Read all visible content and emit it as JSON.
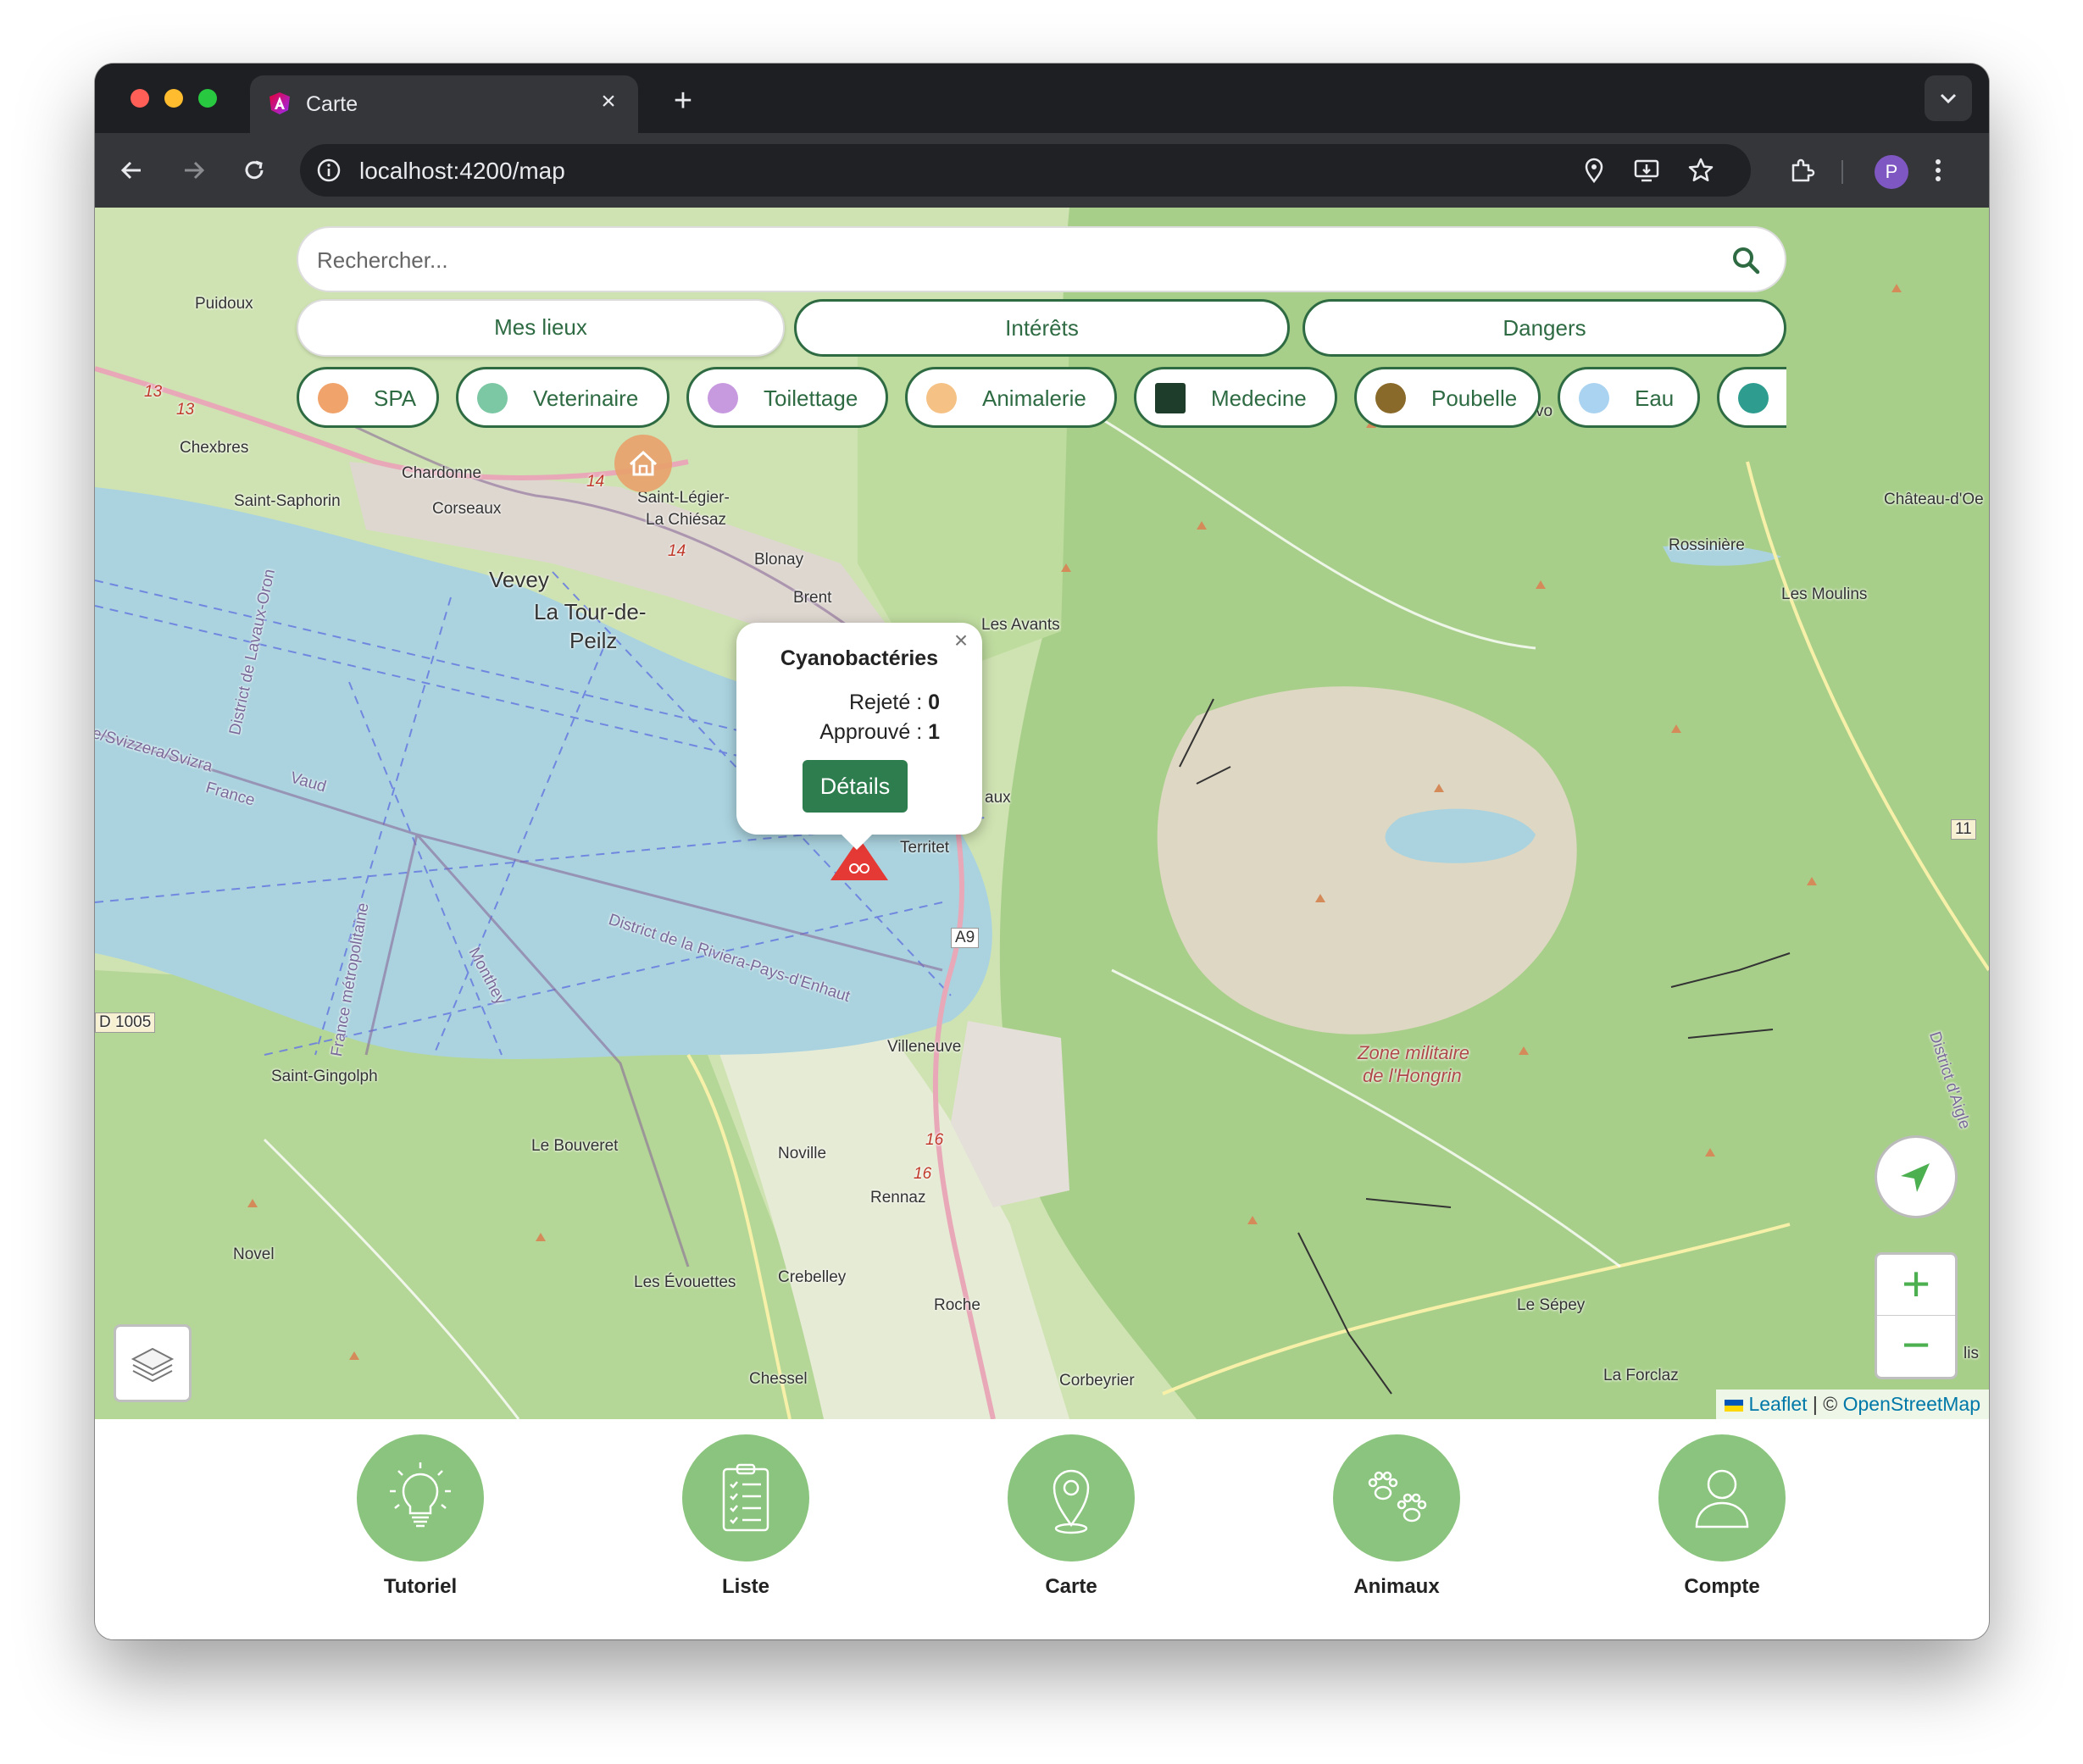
{
  "browser": {
    "tab_title": "Carte",
    "url": "localhost:4200/map",
    "profile_initial": "P"
  },
  "search": {
    "placeholder": "Rechercher..."
  },
  "categories": [
    {
      "label": "Mes lieux",
      "active": true
    },
    {
      "label": "Intérêts",
      "active": false
    },
    {
      "label": "Dangers",
      "active": false
    }
  ],
  "chips": [
    {
      "label": "SPA",
      "icon": "spa-icon",
      "color": "#f0a36b"
    },
    {
      "label": "Veterinaire",
      "icon": "veterinaire-icon",
      "color": "#7cc7a4"
    },
    {
      "label": "Toilettage",
      "icon": "toilettage-icon",
      "color": "#c79ae0"
    },
    {
      "label": "Animalerie",
      "icon": "animalerie-icon",
      "color": "#f5c185"
    },
    {
      "label": "Medecine",
      "icon": "medecine-icon",
      "color": "#1f3d2b"
    },
    {
      "label": "Poubelle",
      "icon": "poubelle-icon",
      "color": "#8a6a2a"
    },
    {
      "label": "Eau",
      "icon": "eau-icon",
      "color": "#a9d3f0"
    },
    {
      "label": "",
      "icon": "other-icon",
      "color": "#2e9c8f"
    }
  ],
  "map": {
    "labels": {
      "puidoux": "Puidoux",
      "chexbres": "Chexbres",
      "chardonne": "Chardonne",
      "saint_saphorin": "Saint-Saphorin",
      "corseaux": "Corseaux",
      "saint_legier": "Saint-Légier-",
      "la_chiesaz": "La Chiésaz",
      "blonay": "Blonay",
      "vevey": "Vevey",
      "la_tour_de": "La Tour-de-",
      "peilz": "Peilz",
      "brent": "Brent",
      "les_avants": "Les Avants",
      "territet": "Territet",
      "aux": "aux",
      "a9": "A9",
      "villeneuve": "Villeneuve",
      "saint_gingolph": "Saint-Gingolph",
      "d1005": "D 1005",
      "le_bouveret": "Le Bouveret",
      "noville": "Noville",
      "rennaz": "Rennaz",
      "novel": "Novel",
      "les_evouettes": "Les Évouettes",
      "crebelley": "Crebelley",
      "roche": "Roche",
      "chessel": "Chessel",
      "corbeyrier": "Corbeyrier",
      "le_sepey": "Le Sépey",
      "la_forclaz": "La Forclaz",
      "rossiniere": "Rossinière",
      "les_moulins": "Les Moulins",
      "chateau_doex": "Château-d'Oe",
      "zone_militaire_1": "Zone militaire",
      "zone_militaire_2": "de l'Hongrin",
      "svizzera": "e/Svizzera/Svizra",
      "france": "France",
      "vaud": "Vaud",
      "district_lavaux": "District de Lavaux-Oron",
      "district_riviera": "District de la Riviera-Pays-d'Enhaut",
      "monthey": "Monthey",
      "france_metro": "France métropolitaine",
      "district_aigle": "District d'Aigle",
      "route_13a": "13",
      "route_13b": "13",
      "route_14a": "14",
      "route_14b": "14",
      "route_16a": "16",
      "route_16b": "16",
      "route_11": "11",
      "vo": "vo",
      "lis": "lis"
    }
  },
  "popup": {
    "title": "Cyanobactéries",
    "rejete_label": "Rejeté : ",
    "rejete_value": "0",
    "approuve_label": "Approuvé : ",
    "approuve_value": "1",
    "details_label": "Détails",
    "close_label": "×"
  },
  "controls": {
    "zoom_in": "+",
    "zoom_out": "−"
  },
  "attribution": {
    "leaflet": "Leaflet",
    "separator": " | © ",
    "osm": "OpenStreetMap"
  },
  "bottom_nav": [
    {
      "label": "Tutoriel",
      "icon": "lightbulb-icon"
    },
    {
      "label": "Liste",
      "icon": "clipboard-list-icon"
    },
    {
      "label": "Carte",
      "icon": "map-pin-icon"
    },
    {
      "label": "Animaux",
      "icon": "paws-icon"
    },
    {
      "label": "Compte",
      "icon": "user-icon"
    }
  ],
  "colors": {
    "brand_green": "#2e6b43",
    "button_green": "#2e7d4f",
    "nav_green": "#8bc47e",
    "danger_red": "#e53935",
    "lake_blue": "#aad3df"
  }
}
